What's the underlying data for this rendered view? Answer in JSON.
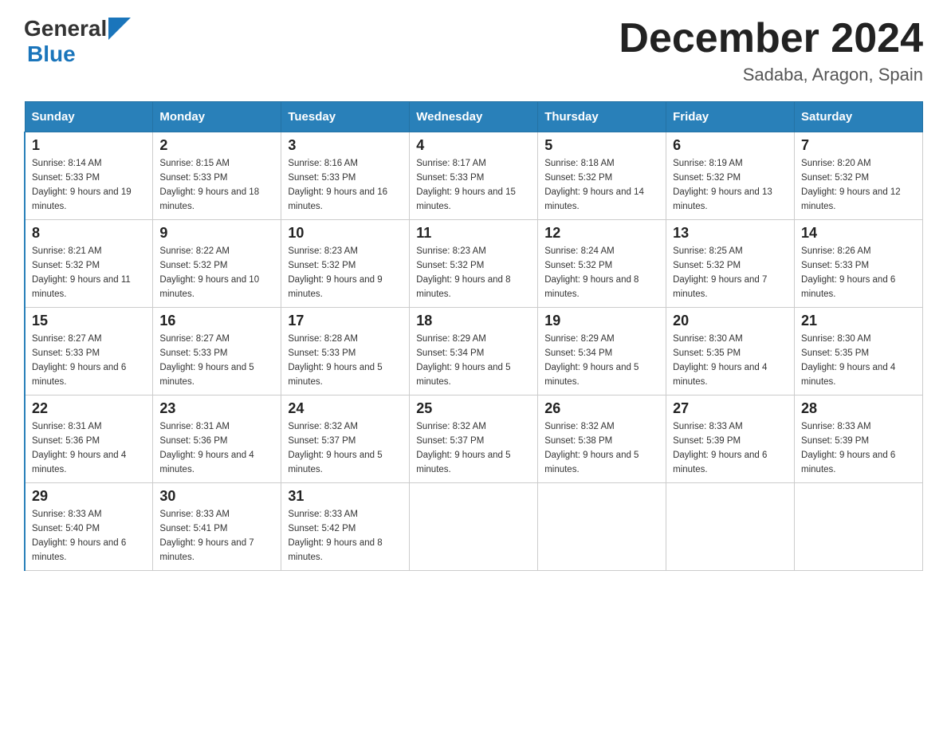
{
  "header": {
    "logo_general": "General",
    "logo_blue": "Blue",
    "month_title": "December 2024",
    "location": "Sadaba, Aragon, Spain"
  },
  "days_of_week": [
    "Sunday",
    "Monday",
    "Tuesday",
    "Wednesday",
    "Thursday",
    "Friday",
    "Saturday"
  ],
  "weeks": [
    [
      {
        "day": "1",
        "sunrise": "8:14 AM",
        "sunset": "5:33 PM",
        "daylight": "9 hours and 19 minutes."
      },
      {
        "day": "2",
        "sunrise": "8:15 AM",
        "sunset": "5:33 PM",
        "daylight": "9 hours and 18 minutes."
      },
      {
        "day": "3",
        "sunrise": "8:16 AM",
        "sunset": "5:33 PM",
        "daylight": "9 hours and 16 minutes."
      },
      {
        "day": "4",
        "sunrise": "8:17 AM",
        "sunset": "5:33 PM",
        "daylight": "9 hours and 15 minutes."
      },
      {
        "day": "5",
        "sunrise": "8:18 AM",
        "sunset": "5:32 PM",
        "daylight": "9 hours and 14 minutes."
      },
      {
        "day": "6",
        "sunrise": "8:19 AM",
        "sunset": "5:32 PM",
        "daylight": "9 hours and 13 minutes."
      },
      {
        "day": "7",
        "sunrise": "8:20 AM",
        "sunset": "5:32 PM",
        "daylight": "9 hours and 12 minutes."
      }
    ],
    [
      {
        "day": "8",
        "sunrise": "8:21 AM",
        "sunset": "5:32 PM",
        "daylight": "9 hours and 11 minutes."
      },
      {
        "day": "9",
        "sunrise": "8:22 AM",
        "sunset": "5:32 PM",
        "daylight": "9 hours and 10 minutes."
      },
      {
        "day": "10",
        "sunrise": "8:23 AM",
        "sunset": "5:32 PM",
        "daylight": "9 hours and 9 minutes."
      },
      {
        "day": "11",
        "sunrise": "8:23 AM",
        "sunset": "5:32 PM",
        "daylight": "9 hours and 8 minutes."
      },
      {
        "day": "12",
        "sunrise": "8:24 AM",
        "sunset": "5:32 PM",
        "daylight": "9 hours and 8 minutes."
      },
      {
        "day": "13",
        "sunrise": "8:25 AM",
        "sunset": "5:32 PM",
        "daylight": "9 hours and 7 minutes."
      },
      {
        "day": "14",
        "sunrise": "8:26 AM",
        "sunset": "5:33 PM",
        "daylight": "9 hours and 6 minutes."
      }
    ],
    [
      {
        "day": "15",
        "sunrise": "8:27 AM",
        "sunset": "5:33 PM",
        "daylight": "9 hours and 6 minutes."
      },
      {
        "day": "16",
        "sunrise": "8:27 AM",
        "sunset": "5:33 PM",
        "daylight": "9 hours and 5 minutes."
      },
      {
        "day": "17",
        "sunrise": "8:28 AM",
        "sunset": "5:33 PM",
        "daylight": "9 hours and 5 minutes."
      },
      {
        "day": "18",
        "sunrise": "8:29 AM",
        "sunset": "5:34 PM",
        "daylight": "9 hours and 5 minutes."
      },
      {
        "day": "19",
        "sunrise": "8:29 AM",
        "sunset": "5:34 PM",
        "daylight": "9 hours and 5 minutes."
      },
      {
        "day": "20",
        "sunrise": "8:30 AM",
        "sunset": "5:35 PM",
        "daylight": "9 hours and 4 minutes."
      },
      {
        "day": "21",
        "sunrise": "8:30 AM",
        "sunset": "5:35 PM",
        "daylight": "9 hours and 4 minutes."
      }
    ],
    [
      {
        "day": "22",
        "sunrise": "8:31 AM",
        "sunset": "5:36 PM",
        "daylight": "9 hours and 4 minutes."
      },
      {
        "day": "23",
        "sunrise": "8:31 AM",
        "sunset": "5:36 PM",
        "daylight": "9 hours and 4 minutes."
      },
      {
        "day": "24",
        "sunrise": "8:32 AM",
        "sunset": "5:37 PM",
        "daylight": "9 hours and 5 minutes."
      },
      {
        "day": "25",
        "sunrise": "8:32 AM",
        "sunset": "5:37 PM",
        "daylight": "9 hours and 5 minutes."
      },
      {
        "day": "26",
        "sunrise": "8:32 AM",
        "sunset": "5:38 PM",
        "daylight": "9 hours and 5 minutes."
      },
      {
        "day": "27",
        "sunrise": "8:33 AM",
        "sunset": "5:39 PM",
        "daylight": "9 hours and 6 minutes."
      },
      {
        "day": "28",
        "sunrise": "8:33 AM",
        "sunset": "5:39 PM",
        "daylight": "9 hours and 6 minutes."
      }
    ],
    [
      {
        "day": "29",
        "sunrise": "8:33 AM",
        "sunset": "5:40 PM",
        "daylight": "9 hours and 6 minutes."
      },
      {
        "day": "30",
        "sunrise": "8:33 AM",
        "sunset": "5:41 PM",
        "daylight": "9 hours and 7 minutes."
      },
      {
        "day": "31",
        "sunrise": "8:33 AM",
        "sunset": "5:42 PM",
        "daylight": "9 hours and 8 minutes."
      },
      null,
      null,
      null,
      null
    ]
  ]
}
